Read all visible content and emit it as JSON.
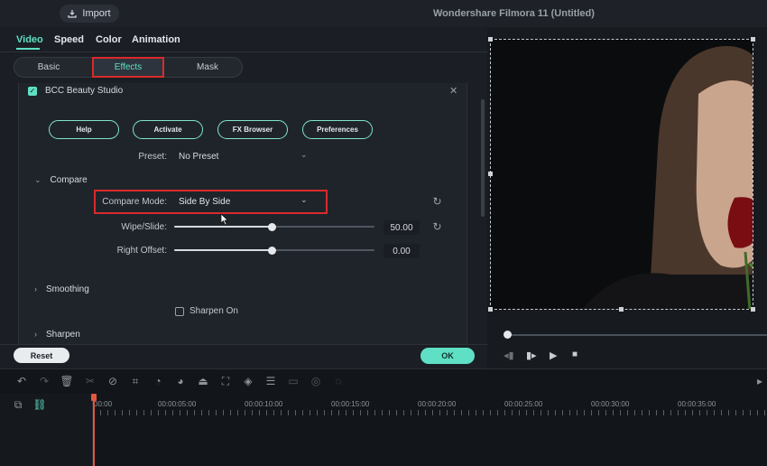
{
  "header": {
    "import_label": "Import",
    "app_title": "Wondershare Filmora 11 (Untitled)"
  },
  "tabs": [
    {
      "label": "Video",
      "active": true
    },
    {
      "label": "Speed",
      "active": false
    },
    {
      "label": "Color",
      "active": false
    },
    {
      "label": "Animation",
      "active": false
    }
  ],
  "segments": {
    "basic": "Basic",
    "effects": "Effects",
    "mask": "Mask",
    "selected": "Effects"
  },
  "effect": {
    "name": "BCC Beauty Studio",
    "enabled": true,
    "buttons": {
      "help": "Help",
      "activate": "Activate",
      "fx_browser": "FX Browser",
      "preferences": "Preferences"
    },
    "preset_label": "Preset:",
    "preset_value": "No Preset",
    "sections": {
      "compare": "Compare",
      "smoothing": "Smoothing",
      "sharpen": "Sharpen"
    },
    "compare_mode_label": "Compare Mode:",
    "compare_mode_value": "Side By Side",
    "wipe_slide_label": "Wipe/Slide:",
    "wipe_slide_value": "50.00",
    "right_offset_label": "Right Offset:",
    "right_offset_value": "0.00",
    "sharpen_on_label": "Sharpen On",
    "sharpen_on_checked": false
  },
  "footer": {
    "reset_label": "Reset",
    "ok_label": "OK"
  },
  "timeline": {
    "timecodes": [
      "00:00",
      "00:00:05:00",
      "00:00:10:00",
      "00:00:15:00",
      "00:00:20:00",
      "00:00:25:00",
      "00:00:30:00",
      "00:00:35:00"
    ]
  },
  "colors": {
    "accent": "#5fe0c4",
    "highlight_box": "#d92a2a",
    "playhead": "#e0583f"
  }
}
